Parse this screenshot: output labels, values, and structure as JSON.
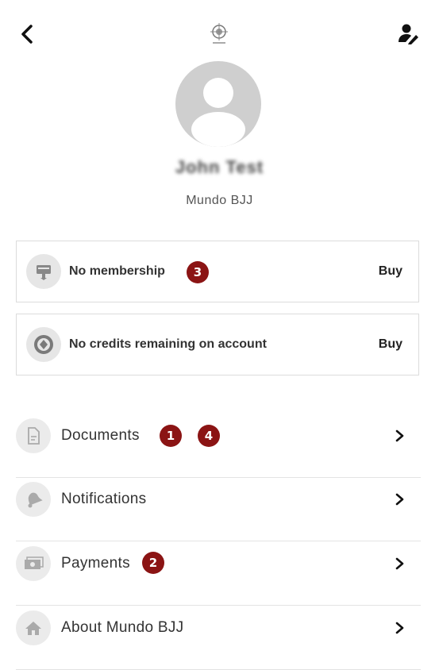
{
  "header": {
    "back_icon": "chevron-left-icon",
    "logo": "gym-crest-logo",
    "edit_icon": "edit-profile-icon"
  },
  "profile": {
    "avatar_icon": "user-avatar-placeholder",
    "name": "John Test",
    "gym": "Mundo BJJ"
  },
  "cards": [
    {
      "icon": "membership-card-icon",
      "label": "No membership",
      "action": "Buy"
    },
    {
      "icon": "credits-icon",
      "label": "No credits remaining on account",
      "action": "Buy"
    }
  ],
  "menu": [
    {
      "icon": "document-icon",
      "label": "Documents"
    },
    {
      "icon": "bell-icon",
      "label": "Notifications"
    },
    {
      "icon": "payment-icon",
      "label": "Payments"
    },
    {
      "icon": "home-icon",
      "label": "About Mundo BJJ"
    }
  ],
  "annotations": {
    "documents_a": "1",
    "documents_b": "4",
    "payments": "2",
    "membership": "3"
  },
  "colors": {
    "badge": "#8b1414",
    "icon_bg": "#e6e6e6",
    "avatar_bg": "#cfcfcf"
  }
}
